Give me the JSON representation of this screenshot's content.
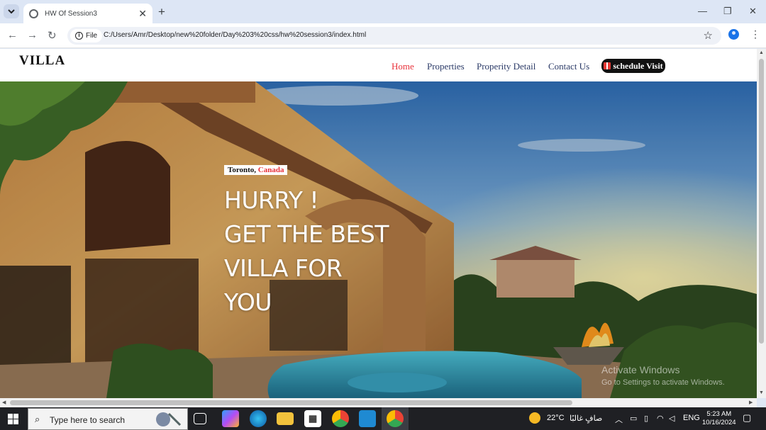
{
  "browser": {
    "tab_title": "HW Of Session3",
    "site_chip": "File",
    "url": "C:/Users/Amr/Desktop/new%20folder/Day%203%20css/hw%20session3/index.html",
    "icons": [
      "tab-search-icon",
      "globe-icon",
      "close-icon",
      "plus-icon",
      "minimize-icon",
      "restore-icon",
      "close-window-icon",
      "back-icon",
      "forward-icon",
      "reload-icon",
      "info-icon",
      "star-icon",
      "profile-icon",
      "kebab-icon"
    ]
  },
  "site": {
    "logo": "VILLA",
    "nav": [
      "Home",
      "Properties",
      "Properity Detail",
      "Contact Us"
    ],
    "cta": "schedule Visit",
    "location_city": "Toronto, ",
    "location_country": "Canada",
    "headline_lines": [
      "HURRY !",
      "GET THE BEST",
      "VILLA FOR",
      "YOU"
    ]
  },
  "watermark": {
    "title": "Activate Windows",
    "subtitle": "Go to Settings to activate Windows."
  },
  "taskbar": {
    "search_placeholder": "Type here to search",
    "temperature": "22°C",
    "weather_text": "صافٍ غالبًا",
    "language": "ENG",
    "time": "5:23 AM",
    "date": "10/16/2024"
  },
  "colors": {
    "accent_red": "#e8323b",
    "nav_text": "#2b3a67",
    "cta_bg": "#111111"
  }
}
